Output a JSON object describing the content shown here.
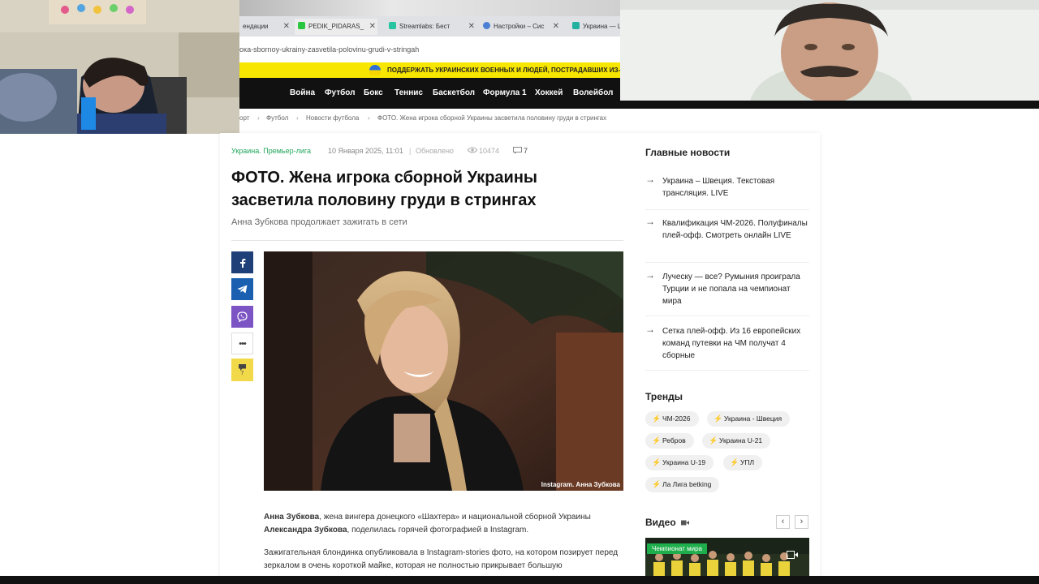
{
  "browser": {
    "tabs": [
      {
        "label": "ендации"
      },
      {
        "label": "PEDIK_PIDARAS_",
        "fav_color": "#2ac640",
        "fav_letter": "K"
      },
      {
        "label": "Streamlabs: Бест",
        "fav_color": "#26c4a0"
      },
      {
        "label": "Настройки – Сис",
        "fav_color": "#4a7fd4"
      },
      {
        "label": "Украина — Ц",
        "fav_color": "#22b0a0"
      }
    ],
    "url": "ока-sbornoy-ukrainy-zasvetila-polovinu-grudi-v-stringah"
  },
  "banner": {
    "text": "ПОДДЕРЖАТЬ УКРАИНСКИХ ВОЕННЫХ И ЛЮДЕЙ, ПОСТРАДАВШИХ ИЗ-"
  },
  "nav": {
    "items": [
      "Война",
      "Футбол",
      "Бокс",
      "Теннис",
      "Баскетбол",
      "Формула 1",
      "Хоккей",
      "Волейбол"
    ]
  },
  "breadcrumb": [
    "орт",
    "Футбол",
    "Новости футбола",
    "ФОТО. Жена игрока сборной Украины засветила половину груди в стрингах"
  ],
  "article": {
    "category": "Украина. Премьер-лига",
    "date": "10 Января 2025, 11:01",
    "updated": "Обновлено",
    "views": "10474",
    "comments": "7",
    "title": "ФОТО. Жена игрока сборной Украины засветила половину груди в стрингах",
    "lead": "Анна Зубкова продолжает зажигать в сети",
    "photo_caption": "Instagram. Анна Зубкова",
    "p1_name": "Анна Зубкова",
    "p1_mid": ", жена вингера донецкого «Шахтера» и национальной сборной Украины ",
    "p1_name2": "Александра Зубкова",
    "p1_end": ", поделилась горячей фотографией в Instagram.",
    "p2": "Зажигательная блондинка опубликовала в Instagram-stories фото, на котором позирует перед зеркалом в очень короткой майке, которая не полностью прикрывает большую"
  },
  "share": {
    "comments_count": "7"
  },
  "sidebar": {
    "main_news_title": "Главные новости",
    "news": [
      "Украина – Швеция. Текстовая трансляция. LIVE",
      "Квалификация ЧМ-2026. Полуфиналы плей-офф. Смотреть онлайн LIVE",
      "Луческу — все? Румыния проиграла Турции и не попала на чемпионат мира",
      "Сетка плей-офф. Из 16 европейских команд путевки на ЧМ получат 4 сборные"
    ],
    "trends_title": "Тренды",
    "trends": [
      "ЧМ-2026",
      "Украина - Швеция",
      "Ребров",
      "Украина U-21",
      "Украина U-19",
      "УПЛ",
      "Ла Лига betking"
    ],
    "video_title": "Видео",
    "video_badge": "Чемпионат мира"
  },
  "colors": {
    "accent_green": "#21a65b",
    "banner_yellow": "#f7e600",
    "nav_black": "#111111"
  }
}
